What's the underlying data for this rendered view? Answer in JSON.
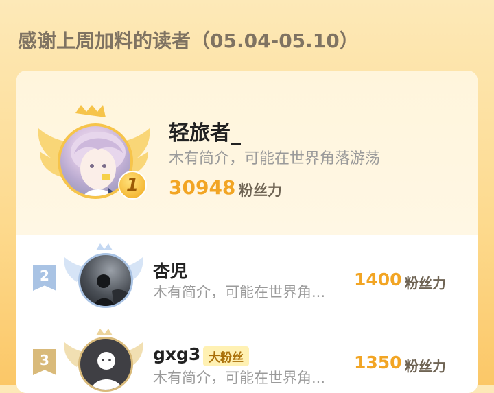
{
  "header": {
    "title": "感谢上周加料的读者（05.04-05.10）"
  },
  "readers": [
    {
      "rank": "1",
      "name": "轻旅者_",
      "bio": "木有简介，可能在世界角落游荡",
      "score": "30948",
      "unit": "粉丝力",
      "avatar": "anime-avatar"
    },
    {
      "rank": "2",
      "name": "杏児",
      "bio": "木有简介，可能在世界角...",
      "score": "1400",
      "unit": "粉丝力",
      "avatar": "silhouette-photo-avatar"
    },
    {
      "rank": "3",
      "name": "gxg3",
      "tag": "大粉丝",
      "bio": "木有简介，可能在世界角...",
      "score": "1350",
      "unit": "粉丝力",
      "avatar": "default-person-avatar"
    }
  ],
  "colors": {
    "accent": "#f2a524",
    "silver": "#a9c3e4",
    "bronze": "#d9ba7a"
  }
}
